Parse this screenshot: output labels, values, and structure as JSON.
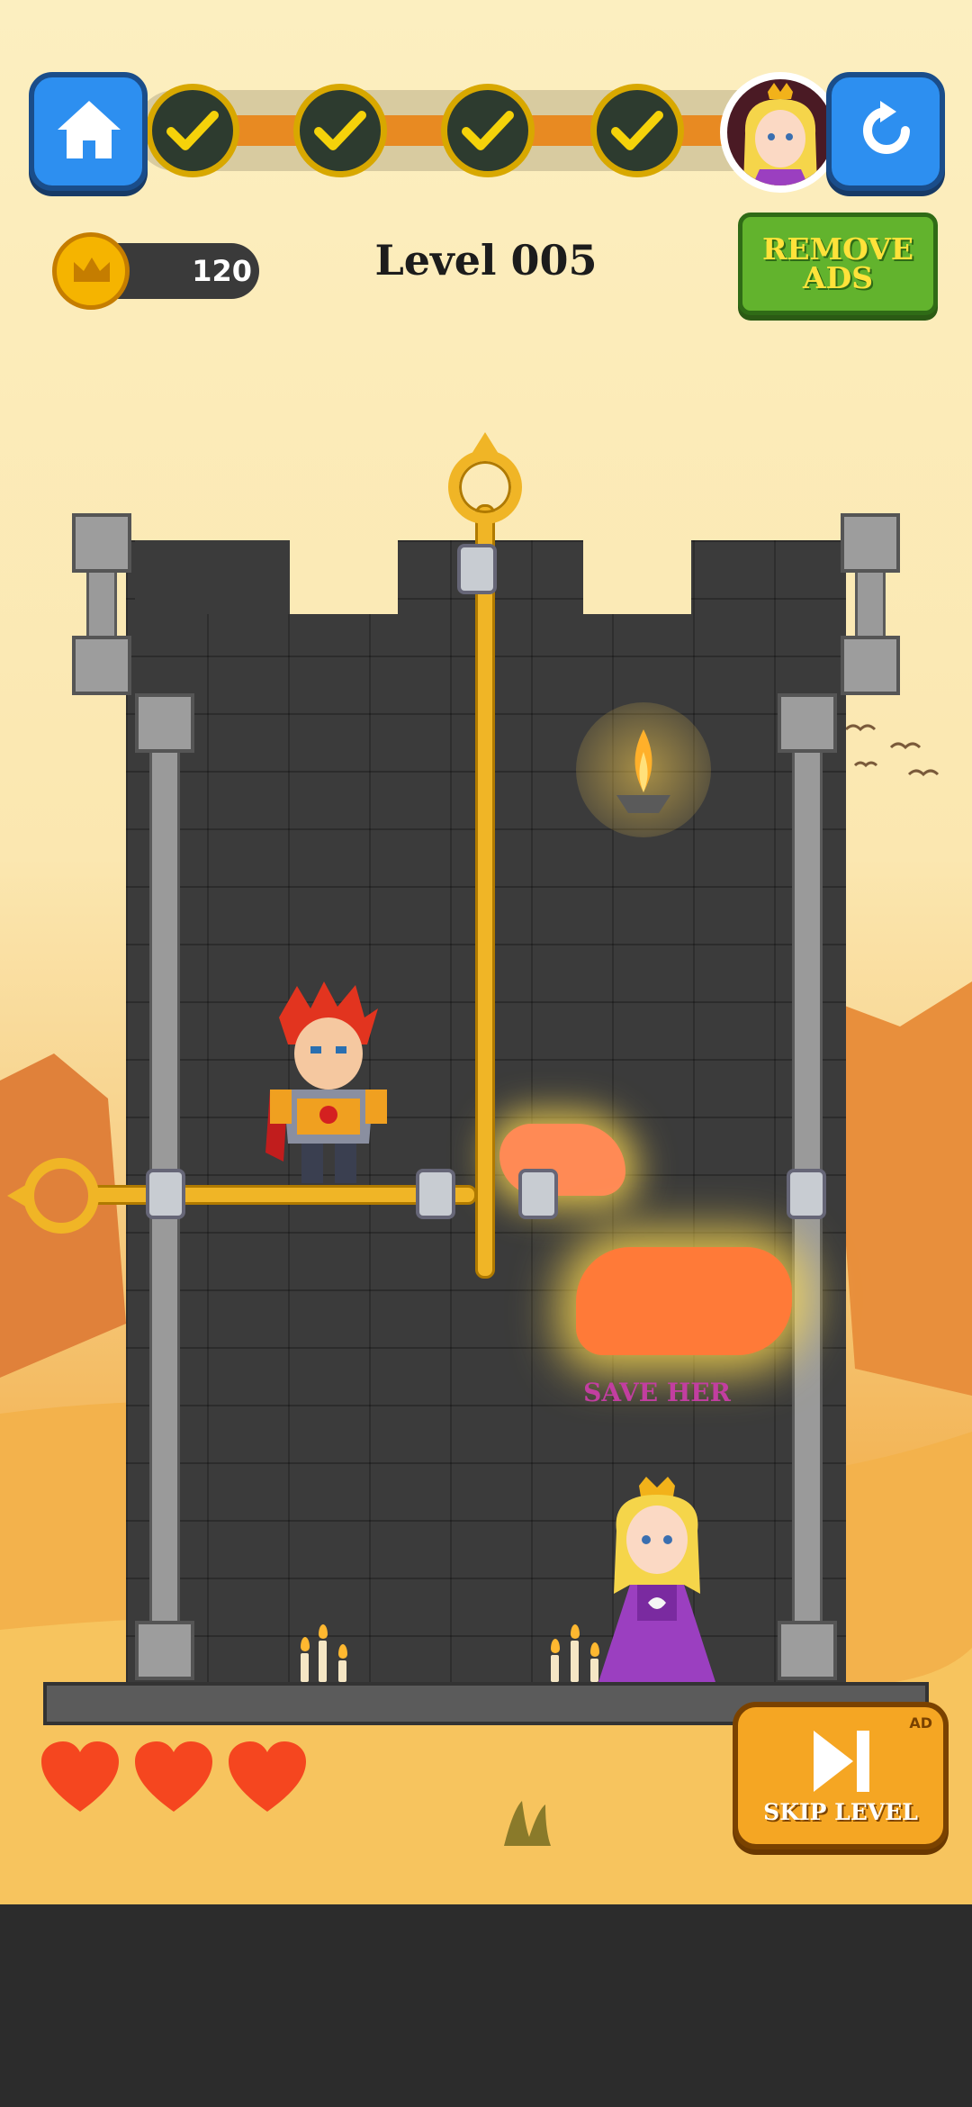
{
  "header": {
    "home_icon": "home-icon",
    "restart_icon": "restart-icon",
    "stages": [
      {
        "icon": "check-icon",
        "state": "completed"
      },
      {
        "icon": "check-icon",
        "state": "completed"
      },
      {
        "icon": "check-icon",
        "state": "completed"
      },
      {
        "icon": "check-icon",
        "state": "completed"
      }
    ],
    "current_stage_icon": "princess-avatar-icon"
  },
  "coins": {
    "value": "120",
    "icon": "crown-coin-icon"
  },
  "level": {
    "title": "Level 005"
  },
  "remove_ads": {
    "line1": "REMOVE",
    "line2": "ADS"
  },
  "puzzle": {
    "hint": "SAVE HER"
  },
  "lives": {
    "count": 3,
    "icon": "heart-icon"
  },
  "skip": {
    "label": "SKIP LEVEL",
    "badge": "AD",
    "icon": "skip-icon"
  },
  "colors": {
    "accent_blue": "#2d8ff0",
    "gold": "#f0b526",
    "lava": "#ff7a38",
    "heart": "#f5461f",
    "green": "#62b32d",
    "skip_orange": "#f5a623"
  }
}
